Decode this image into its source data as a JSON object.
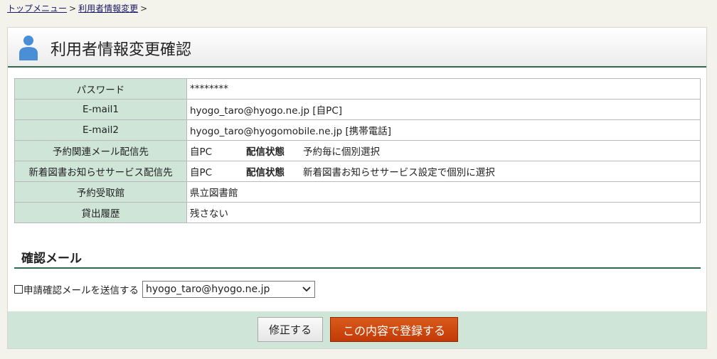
{
  "breadcrumb": {
    "items": [
      "トップメニュー",
      "利用者情報変更"
    ],
    "separator": ">"
  },
  "header": {
    "icon": "user-icon",
    "title": "利用者情報変更確認"
  },
  "info_table": {
    "rows": [
      {
        "label": "パスワード",
        "value": "********"
      },
      {
        "label": "E-mail1",
        "value": "hyogo_taro@hyogo.ne.jp [自PC]"
      },
      {
        "label": "E-mail2",
        "value": "hyogo_taro@hyogomobile.ne.jp [携帯電話]"
      },
      {
        "label": "予約関連メール配信先",
        "destination": "自PC",
        "status_label": "配信状態",
        "status_value": "予約毎に個別選択"
      },
      {
        "label": "新着図書お知らせサービス配信先",
        "destination": "自PC",
        "status_label": "配信状態",
        "status_value": "新着図書お知らせサービス設定で個別に選択"
      },
      {
        "label": "予約受取館",
        "value": "県立図書館"
      },
      {
        "label": "貸出履歴",
        "value": "残さない"
      }
    ]
  },
  "confirm_mail": {
    "section_title": "確認メール",
    "checkbox_label": "申請確認メールを送信する",
    "checked": false,
    "selected_address": "hyogo_taro@hyogo.ne.jp"
  },
  "footer": {
    "modify_label": "修正する",
    "register_label": "この内容で登録する"
  },
  "colors": {
    "label_bg": "#cfe5d8",
    "accent_line": "#2e6b4a",
    "register_button": "#c33a06",
    "icon_blue": "#4a8fd6"
  }
}
